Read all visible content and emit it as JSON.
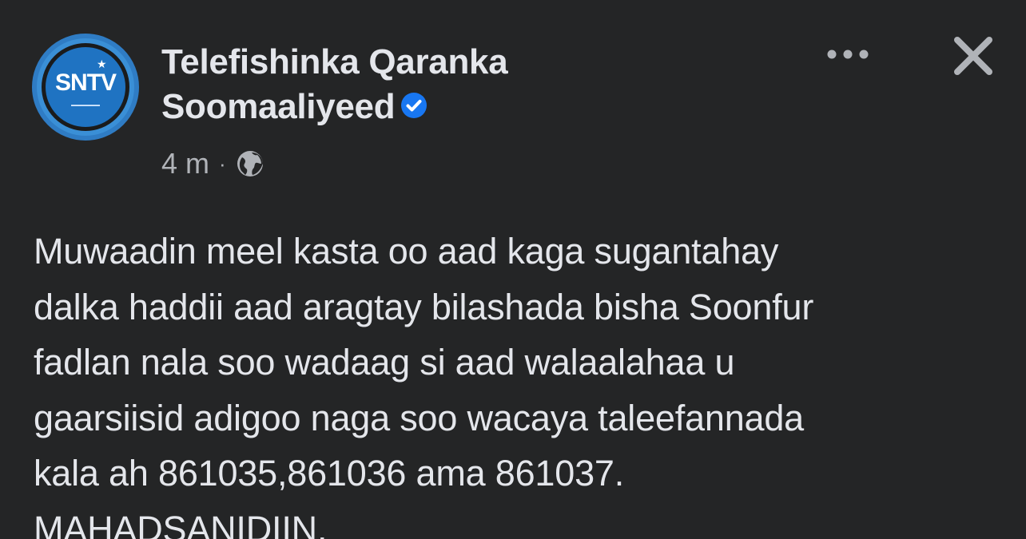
{
  "post": {
    "author": {
      "name_line1": "Telefishinka Qaranka",
      "name_line2": "Soomaaliyeed",
      "avatar_text": "SNTV",
      "verified": true,
      "verified_icon": "verified-badge-icon"
    },
    "meta": {
      "time": "4 m",
      "separator": "·",
      "audience_icon": "globe-icon"
    },
    "actions": {
      "more_icon": "more-options-icon",
      "close_icon": "close-icon"
    },
    "text": "Muwaadin meel kasta oo aad kaga sugantahay\ndalka haddii aad aragtay bilashada bisha Soonfur\nfadlan nala soo wadaag si aad walaalahaa u\ngaarsiisid adigoo naga soo wacaya taleefannada\nkala ah 861035,861036 ama 861037.\nMAHADSANIDIIN."
  },
  "colors": {
    "background": "#242526",
    "primary_text": "#e4e6eb",
    "secondary_text": "#b0b3b8",
    "verified_blue": "#1877f2"
  }
}
